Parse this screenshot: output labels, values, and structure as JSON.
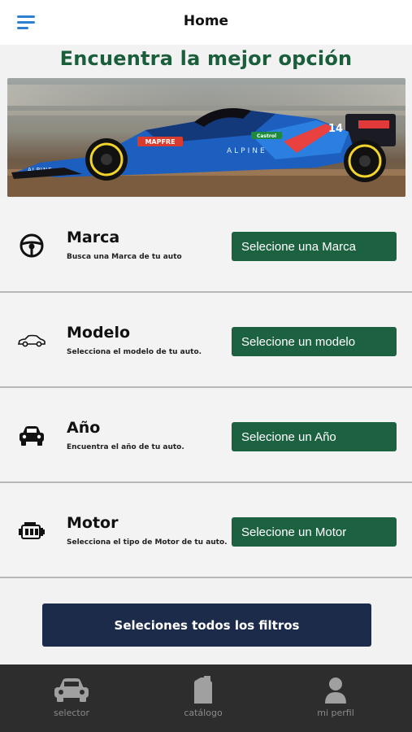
{
  "header": {
    "title": "Home",
    "menu_icon": "hamburger-menu-icon"
  },
  "headline": "Encuentra la mejor opción",
  "filters": [
    {
      "icon": "steering-wheel-icon",
      "title": "Marca",
      "subtitle": "Busca una Marca de tu auto",
      "button": "Selecione una Marca"
    },
    {
      "icon": "car-side-icon",
      "title": "Modelo",
      "subtitle": "Selecciona el modelo de tu auto.",
      "button": "Selecione un modelo"
    },
    {
      "icon": "car-front-icon",
      "title": "Año",
      "subtitle": "Encuentra el año de tu auto.",
      "button": "Selecione un Año"
    },
    {
      "icon": "engine-icon",
      "title": "Motor",
      "subtitle": "Selecciona el tipo de Motor de tu auto.",
      "button": "Selecione un Motor"
    }
  ],
  "primary_button": "Seleciones todos los filtros",
  "tabs": [
    {
      "icon": "car-icon",
      "label": "selector"
    },
    {
      "icon": "catalog-can-icon",
      "label": "catálogo"
    },
    {
      "icon": "profile-icon",
      "label": "mi perfil"
    }
  ],
  "colors": {
    "brand_green": "#1c6240",
    "headline_green": "#1b5e3b",
    "primary_navy": "#1c2b4a",
    "tabbar": "#2d2d2d",
    "menu_blue": "#2f7fd0"
  }
}
